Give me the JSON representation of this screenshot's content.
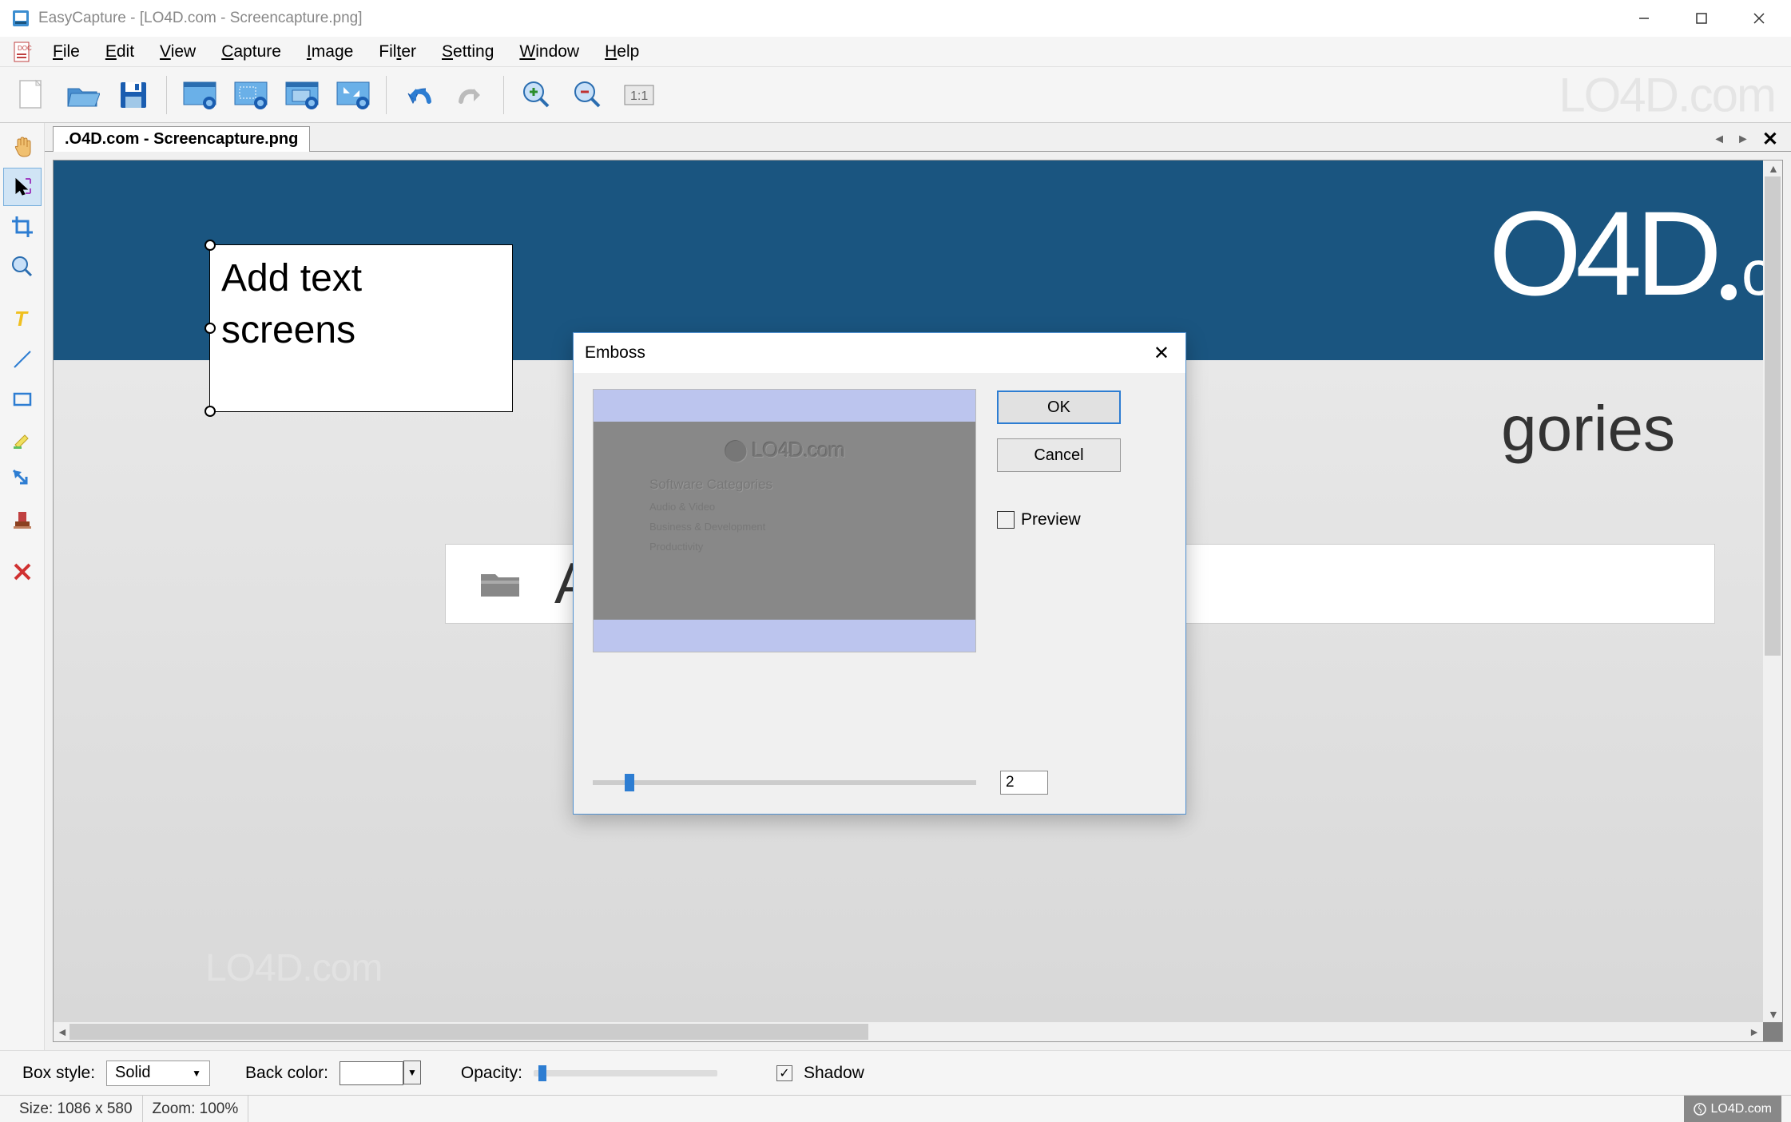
{
  "window": {
    "title": "EasyCapture - [LO4D.com - Screencapture.png]"
  },
  "menu": {
    "items": [
      "File",
      "Edit",
      "View",
      "Capture",
      "Image",
      "Filter",
      "Setting",
      "Window",
      "Help"
    ]
  },
  "toolbar": {
    "watermark": "LO4D.com"
  },
  "tab": {
    "label": ".O4D.com - Screencapture.png"
  },
  "canvas": {
    "banner_text": "O4D",
    "banner_suffix": "com",
    "textbox_line1": "Add text",
    "textbox_line2": "screens",
    "categories_suffix": "gories",
    "audio_video": "Audio & Video",
    "canvas_watermark": "LO4D.com"
  },
  "dialog": {
    "title": "Emboss",
    "ok": "OK",
    "cancel": "Cancel",
    "preview_label": "Preview",
    "value": "2",
    "preview_logo": "LO4D.com",
    "preview_categories": "Software Categories",
    "preview_item1": "Audio & Video",
    "preview_item2": "Business & Development",
    "preview_item3": "Productivity"
  },
  "options": {
    "box_style_label": "Box style:",
    "box_style_value": "Solid",
    "back_color_label": "Back color:",
    "opacity_label": "Opacity:",
    "shadow_label": "Shadow"
  },
  "status": {
    "size_label": "Size: 1086 x 580",
    "zoom_label": "Zoom: 100%"
  },
  "footer": {
    "brand": "LO4D.com"
  }
}
